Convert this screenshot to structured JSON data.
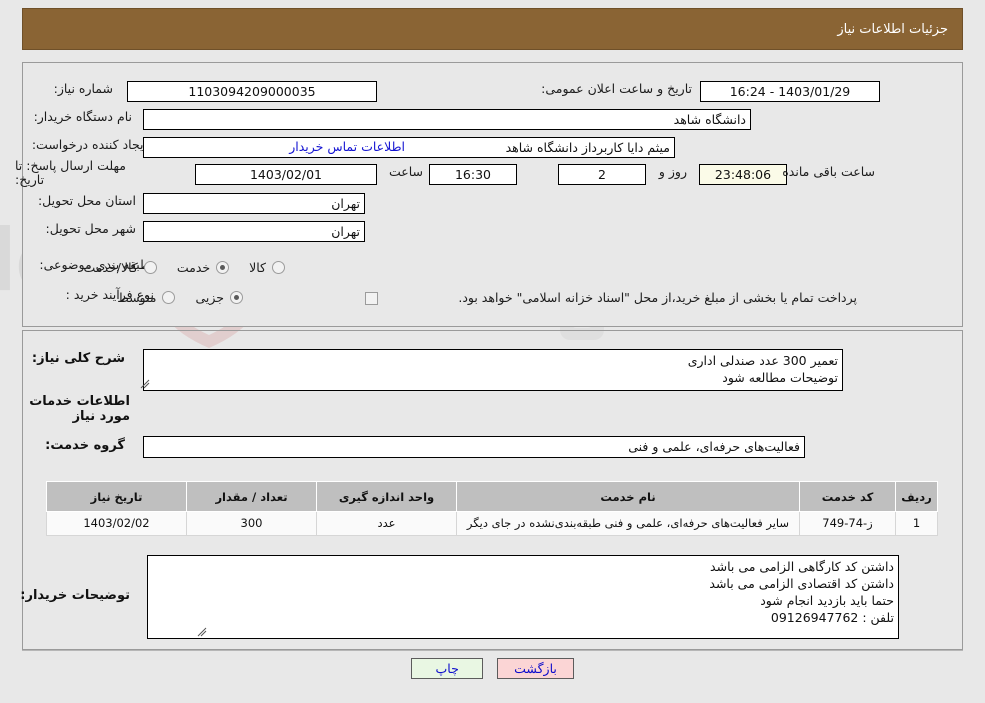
{
  "header": {
    "title": "جزئیات اطلاعات نیاز"
  },
  "form": {
    "need_number_label": "شماره نیاز:",
    "need_number_value": "1103094209000035",
    "announce_datetime_label": "تاریخ و ساعت اعلان عمومی:",
    "announce_datetime_value": "1403/01/29 - 16:24",
    "buyer_org_label": "نام دستگاه خریدار:",
    "buyer_org_value": "دانشگاه شاهد",
    "creator_label": "ایجاد کننده درخواست:",
    "creator_value": "میثم دایا کاربرداز دانشگاه شاهد",
    "contact_link": "اطلاعات تماس خریدار",
    "deadline_label": "مهلت ارسال پاسخ: تا تاریخ:",
    "deadline_date": "1403/02/01",
    "hour_label": "ساعت",
    "deadline_time": "16:30",
    "days_value": "2",
    "days_label": "روز و",
    "remaining_timer": "23:48:06",
    "remaining_label": "ساعت باقی مانده",
    "province_label": "استان محل تحویل:",
    "province_value": "تهران",
    "city_label": "شهر محل تحویل:",
    "city_value": "تهران",
    "category_label": "طبقه بندی موضوعی:",
    "category_options": [
      {
        "label": "کالا",
        "checked": false
      },
      {
        "label": "خدمت",
        "checked": true
      },
      {
        "label": "کالا/خدمت",
        "checked": false
      }
    ],
    "process_label": "نوع فرآیند خرید :",
    "process_options": [
      {
        "label": "جزیی",
        "checked": true
      },
      {
        "label": "متوسط",
        "checked": false
      }
    ],
    "treasury_checkbox_checked": false,
    "treasury_note": "پرداخت تمام یا بخشی از مبلغ خرید،از محل \"اسناد خزانه اسلامی\" خواهد بود."
  },
  "need_desc": {
    "label": "شرح کلی نیاز:",
    "value": "تعمیر 300 عدد صندلی اداری\nتوضیحات مطالعه شود"
  },
  "services_section": {
    "title": "اطلاعات خدمات مورد نیاز",
    "group_label": "گروه خدمت:",
    "group_value": "فعالیت‌های حرفه‌ای، علمی و فنی"
  },
  "table": {
    "columns": [
      "ردیف",
      "کد خدمت",
      "نام خدمت",
      "واحد اندازه گیری",
      "تعداد / مقدار",
      "تاریخ نیاز"
    ],
    "rows": [
      {
        "row_no": "1",
        "service_code": "ز-74-749",
        "service_name": "سایر فعالیت‌های حرفه‌ای، علمی و فنی طبقه‌بندی‌نشده در جای دیگر",
        "unit": "عدد",
        "quantity": "300",
        "need_date": "1403/02/02"
      }
    ]
  },
  "buyer_notes": {
    "label": "توضیحات خریدار:",
    "value": "داشتن کد کارگاهی الزامی می باشد\nداشتن کد اقتصادی الزامی می باشد\nحتما باید بازدید انجام شود\nتلفن : 09126947762"
  },
  "buttons": {
    "back": "بازگشت",
    "print": "چاپ"
  },
  "watermark": {
    "text": "AnaTender.net"
  },
  "colors": {
    "header_bg": "#8a6434",
    "header_text": "#ffffff",
    "link": "#1414d2",
    "table_header_bg": "#bfbfbf",
    "back_btn_bg": "#fbd5d5",
    "print_btn_bg": "#e9f7e3",
    "timer_bg": "#fbfbe8",
    "page_bg": "#e8e8e8"
  }
}
